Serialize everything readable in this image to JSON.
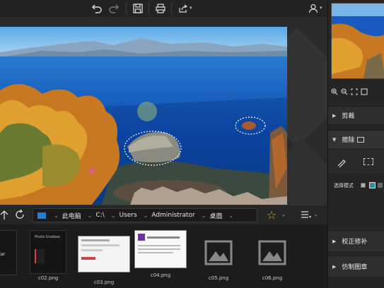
{
  "toolbar": {
    "buttons": [
      "undo-icon",
      "redo-icon",
      "save-icon",
      "print-icon",
      "share-icon",
      "user-icon"
    ]
  },
  "path": {
    "segments": [
      "此电脑",
      "C:\\",
      "Users",
      "Administrator",
      "桌面"
    ]
  },
  "thumbnails": [
    {
      "name": "",
      "kind": "doc-dark"
    },
    {
      "name": "c02.png",
      "kind": "app-dark"
    },
    {
      "name": "c03.png",
      "kind": "dialog"
    },
    {
      "name": "c04.png",
      "kind": "installer"
    },
    {
      "name": "c05.png",
      "kind": "placeholder"
    },
    {
      "name": "c06.png",
      "kind": "placeholder"
    }
  ],
  "right_panel": {
    "sections": [
      {
        "label": "剪裁"
      },
      {
        "label": "擦除"
      },
      {
        "label": "校正修补"
      },
      {
        "label": "仿制图章"
      }
    ],
    "select_mode_label": "选择模式"
  },
  "colors": {
    "accent_teal": "#1a9aa0",
    "star_orange": "#f0a020",
    "bg_dark": "#1e1e1e"
  }
}
